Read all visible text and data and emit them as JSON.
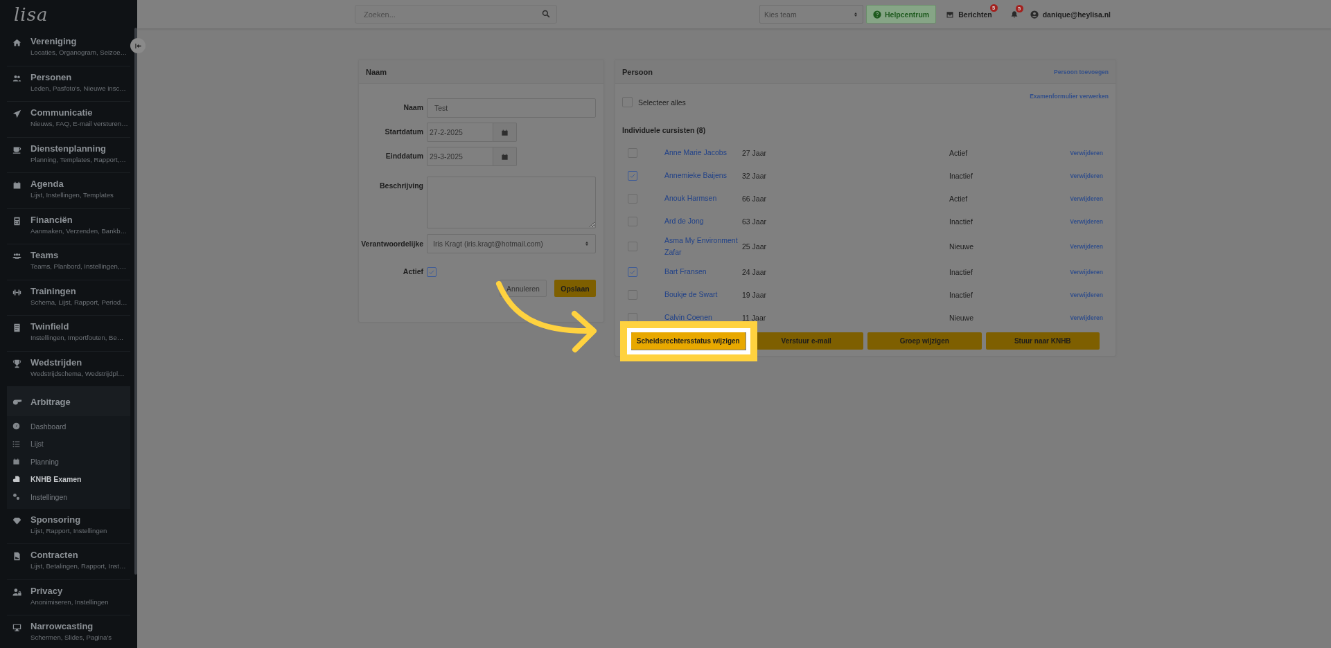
{
  "sidebar": {
    "logo": "lisa",
    "items": [
      {
        "title": "Vereniging",
        "subtitle": "Locaties, Organogram, Seizoe…",
        "expanded": false
      },
      {
        "title": "Personen",
        "subtitle": "Leden, Pasfoto's, Nieuwe insc…",
        "expanded": false
      },
      {
        "title": "Communicatie",
        "subtitle": "Nieuws, FAQ, E-mail versturen…",
        "expanded": false
      },
      {
        "title": "Dienstenplanning",
        "subtitle": "Planning, Templates, Rapport,…",
        "expanded": false
      },
      {
        "title": "Agenda",
        "subtitle": "Lijst, Instellingen, Templates",
        "expanded": false
      },
      {
        "title": "Financiën",
        "subtitle": "Aanmaken, Verzenden, Bankb…",
        "expanded": false
      },
      {
        "title": "Teams",
        "subtitle": "Teams, Planbord, Instellingen,…",
        "expanded": false
      },
      {
        "title": "Trainingen",
        "subtitle": "Schema, Lijst, Rapport, Period…",
        "expanded": false
      },
      {
        "title": "Twinfield",
        "subtitle": "Instellingen, Importfouten, Be…",
        "expanded": false
      },
      {
        "title": "Wedstrijden",
        "subtitle": "Wedstrijdschema, Wedstrijdpl…",
        "expanded": false
      },
      {
        "title": "Arbitrage",
        "expanded": true,
        "children": [
          {
            "label": "Dashboard",
            "selected": false
          },
          {
            "label": "Lijst",
            "selected": false
          },
          {
            "label": "Planning",
            "selected": false
          },
          {
            "label": "KNHB Examen",
            "selected": true
          },
          {
            "label": "Instellingen",
            "selected": false
          }
        ]
      },
      {
        "title": "Sponsoring",
        "subtitle": "Lijst, Rapport, Instellingen",
        "expanded": false
      },
      {
        "title": "Contracten",
        "subtitle": "Lijst, Betalingen, Rapport, Inst…",
        "expanded": false
      },
      {
        "title": "Privacy",
        "subtitle": "Anonimiseren, Instellingen",
        "expanded": false
      },
      {
        "title": "Narrowcasting",
        "subtitle": "Schermen, Slides, Pagina's",
        "expanded": false
      }
    ]
  },
  "topbar": {
    "search": {
      "placeholder": "Zoeken..."
    },
    "team_select": {
      "value": "Kies team"
    },
    "help_button": "Helpcentrum",
    "messages": {
      "label": "Berichten",
      "badge": "5"
    },
    "notifications": {
      "badge": "5"
    },
    "user": "danique@heylisa.nl"
  },
  "form_card": {
    "title": "Naam",
    "fields": [
      {
        "kind": "text",
        "label": "Naam",
        "value": "Test"
      },
      {
        "kind": "date",
        "label": "Startdatum",
        "value": "27-2-2025"
      },
      {
        "kind": "date",
        "label": "Einddatum",
        "value": "29-3-2025"
      },
      {
        "kind": "textarea",
        "label": "Beschrijving"
      },
      {
        "kind": "select",
        "label": "Verantwoordelijke",
        "value": "Iris Kragt (iris.kragt@hotmail.com)"
      },
      {
        "kind": "checkbox",
        "label": "Actief",
        "checked": true
      }
    ],
    "buttons": [
      {
        "label": "Annuleren",
        "kind": "secondary"
      },
      {
        "label": "Opslaan",
        "kind": "primary"
      }
    ]
  },
  "person_card": {
    "title": "Persoon",
    "add_link": "Persoon toevoegen",
    "select_all": {
      "label": "Selecteer alles",
      "checked": false
    },
    "process_link": "Examenformulier verwerken",
    "group_title": "Individuele cursisten (8)",
    "rows": [
      {
        "name": "Anne Marie Jacobs",
        "age": "27 Jaar",
        "status": "Actief",
        "action": "Verwijderen",
        "checked": false
      },
      {
        "name": "Annemieke Baijens",
        "age": "32 Jaar",
        "status": "Inactief",
        "action": "Verwijderen",
        "checked": true
      },
      {
        "name": "Anouk Harmsen",
        "age": "66 Jaar",
        "status": "Actief",
        "action": "Verwijderen",
        "checked": false
      },
      {
        "name": "Ard de Jong",
        "age": "63 Jaar",
        "status": "Inactief",
        "action": "Verwijderen",
        "checked": false
      },
      {
        "name": "Asma My Environment Zafar",
        "age": "25 Jaar",
        "status": "Nieuwe",
        "action": "Verwijderen",
        "checked": false
      },
      {
        "name": "Bart Fransen",
        "age": "24 Jaar",
        "status": "Inactief",
        "action": "Verwijderen",
        "checked": true
      },
      {
        "name": "Boukje de Swart",
        "age": "19 Jaar",
        "status": "Inactief",
        "action": "Verwijderen",
        "checked": false
      },
      {
        "name": "Calvin Coenen",
        "age": "11 Jaar",
        "status": "Nieuwe",
        "action": "Verwijderen",
        "checked": false
      }
    ],
    "buttons": [
      {
        "label": "Scheidsrechtersstatus wijzigen",
        "highlighted": true
      },
      {
        "label": "Verstuur e-mail",
        "highlighted": false
      },
      {
        "label": "Groep wijzigen",
        "highlighted": false
      },
      {
        "label": "Stuur naar KNHB",
        "highlighted": false
      }
    ]
  }
}
